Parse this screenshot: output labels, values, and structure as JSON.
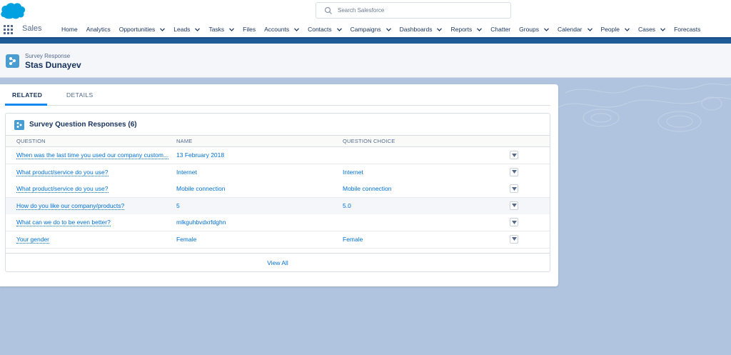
{
  "search": {
    "placeholder": "Search Salesforce"
  },
  "nav": {
    "app_name": "Sales",
    "items": [
      {
        "label": "Home",
        "menu": false
      },
      {
        "label": "Analytics",
        "menu": false
      },
      {
        "label": "Opportunities",
        "menu": true
      },
      {
        "label": "Leads",
        "menu": true
      },
      {
        "label": "Tasks",
        "menu": true
      },
      {
        "label": "Files",
        "menu": false
      },
      {
        "label": "Accounts",
        "menu": true
      },
      {
        "label": "Contacts",
        "menu": true
      },
      {
        "label": "Campaigns",
        "menu": true
      },
      {
        "label": "Dashboards",
        "menu": true
      },
      {
        "label": "Reports",
        "menu": true
      },
      {
        "label": "Chatter",
        "menu": false
      },
      {
        "label": "Groups",
        "menu": true
      },
      {
        "label": "Calendar",
        "menu": true
      },
      {
        "label": "People",
        "menu": true
      },
      {
        "label": "Cases",
        "menu": true
      },
      {
        "label": "Forecasts",
        "menu": false
      }
    ]
  },
  "record": {
    "type": "Survey Response",
    "name": "Stas Dunayev"
  },
  "tabs": [
    {
      "label": "RELATED",
      "active": true
    },
    {
      "label": "DETAILS",
      "active": false
    }
  ],
  "related_list": {
    "title": "Survey Question Responses (6)",
    "columns": [
      "QUESTION",
      "NAME",
      "QUESTION CHOICE"
    ],
    "rows": [
      {
        "question": "When was the last time you used our company custom...",
        "name": "13 February 2018",
        "choice": ""
      },
      {
        "question": "What product/service do you use?",
        "name": "Internet",
        "choice": "Internet"
      },
      {
        "question": "What product/service do you use?",
        "name": "Mobile connection",
        "choice": "Mobile connection"
      },
      {
        "question": "How do you like our company/products?",
        "name": "5",
        "choice": "5.0"
      },
      {
        "question": "What can we do to be even better?",
        "name": "mlkguhbvdxrfdghn",
        "choice": ""
      },
      {
        "question": "Your gender",
        "name": "Female",
        "choice": "Female"
      }
    ],
    "view_all": "View All"
  },
  "colors": {
    "brand_band": "#1f5b97",
    "link": "#0070d2",
    "record_icon": "#4a9dd1",
    "background": "#b0c4df"
  }
}
